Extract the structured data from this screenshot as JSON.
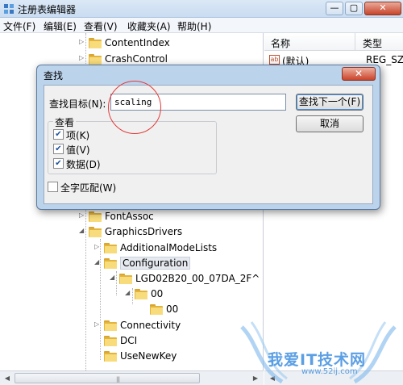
{
  "window": {
    "title": "注册表编辑器",
    "controls": {
      "minimize": "—",
      "maximize": "▢",
      "close": "✕"
    }
  },
  "menu": [
    {
      "label": "文件(F)"
    },
    {
      "label": "编辑(E)"
    },
    {
      "label": "查看(V)"
    },
    {
      "label": "收藏夹(A)"
    },
    {
      "label": "帮助(H)"
    }
  ],
  "tree": [
    {
      "label": "ContentIndex",
      "arrow": "▷"
    },
    {
      "label": "CrashControl",
      "arrow": "▷"
    },
    {
      "label": "FontAssoc",
      "arrow": "▷"
    },
    {
      "label": "GraphicsDrivers",
      "arrow": "◢"
    },
    {
      "label": "AdditionalModeLists",
      "arrow": "▷"
    },
    {
      "label": "Configuration",
      "arrow": "◢"
    },
    {
      "label": "LGD02B20_00_07DA_2F^",
      "arrow": "◢"
    },
    {
      "label": "00",
      "arrow": "◢"
    },
    {
      "label": "00",
      "arrow": ""
    },
    {
      "label": "Connectivity",
      "arrow": "▷"
    },
    {
      "label": "DCI",
      "arrow": ""
    },
    {
      "label": "UseNewKey",
      "arrow": ""
    }
  ],
  "list": {
    "col_name": "名称",
    "col_type": "类型",
    "rows": [
      {
        "icon": "ab",
        "name": "(默认)",
        "type": "REG_SZ"
      }
    ]
  },
  "dialog": {
    "title": "查找",
    "close": "✕",
    "find_label": "查找目标(N):",
    "find_value": "scaling",
    "find_next_button": "查找下一个(F)",
    "cancel_button": "取消",
    "look_at_group": "查看",
    "checkboxes": [
      {
        "label": "项(K)",
        "checked": true
      },
      {
        "label": "值(V)",
        "checked": true
      },
      {
        "label": "数据(D)",
        "checked": true
      }
    ],
    "match_whole": {
      "label": "全字匹配(W)",
      "checked": false
    }
  },
  "watermark": {
    "text": "我爱IT技术网",
    "url": "www.52ij.com"
  },
  "colors": {
    "annotation_circle": "#e33a3a",
    "folder": "#f8dc7c",
    "watermark": "#3f8fe0"
  }
}
